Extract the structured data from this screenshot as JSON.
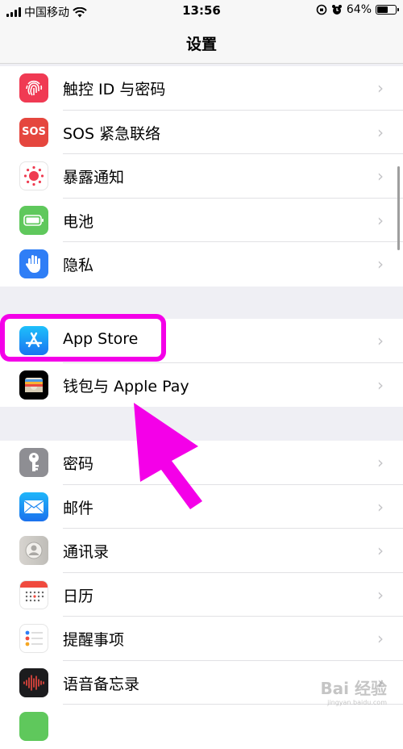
{
  "status": {
    "carrier": "中国移动",
    "time": "13:56",
    "battery_pct": "64%",
    "battery_level": 0.64
  },
  "nav": {
    "title": "设置"
  },
  "group1": [
    {
      "label": "触控 ID 与密码",
      "icon": "fingerprint-icon"
    },
    {
      "label": "SOS 紧急联络",
      "icon": "sos-icon"
    },
    {
      "label": "暴露通知",
      "icon": "exposure-notification-icon"
    },
    {
      "label": "电池",
      "icon": "battery-icon"
    },
    {
      "label": "隐私",
      "icon": "privacy-hand-icon"
    }
  ],
  "group2": [
    {
      "label": "App Store",
      "icon": "app-store-icon"
    },
    {
      "label": "钱包与 Apple Pay",
      "icon": "wallet-icon"
    }
  ],
  "group3": [
    {
      "label": "密码",
      "icon": "key-icon"
    },
    {
      "label": "邮件",
      "icon": "mail-icon"
    },
    {
      "label": "通讯录",
      "icon": "contacts-icon"
    },
    {
      "label": "日历",
      "icon": "calendar-icon"
    },
    {
      "label": "提醒事项",
      "icon": "reminders-icon"
    },
    {
      "label": "语音备忘录",
      "icon": "voice-memos-icon"
    }
  ],
  "sos_icon_text": "SOS",
  "chevron": "›",
  "watermark": {
    "text": "Bai 经验",
    "sub": "jingyan.baidu.com"
  },
  "colors": {
    "highlight": "#f400e8",
    "background": "#efeff4"
  }
}
